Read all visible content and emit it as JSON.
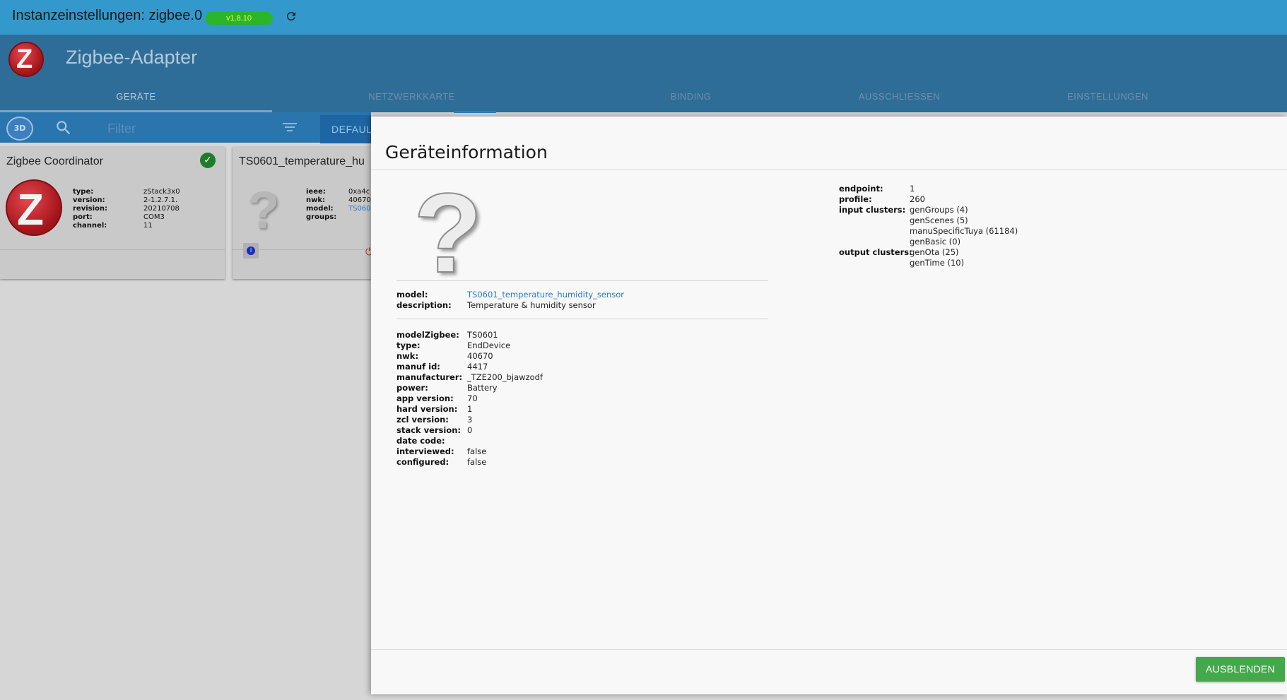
{
  "window": {
    "title": "Instanzeinstellungen: zigbee.0",
    "version": "v1.8.10"
  },
  "app": {
    "title": "Zigbee-Adapter",
    "logo_letter": "Z"
  },
  "tabs": [
    {
      "label": "GERÄTE"
    },
    {
      "label": "NETZWERKKARTE"
    },
    {
      "label": "BINDING"
    },
    {
      "label": "AUSSCHLIESSEN"
    },
    {
      "label": "EINSTELLUNGEN"
    }
  ],
  "toolbar": {
    "btn3d_label": "3D",
    "filter_placeholder": "Filter",
    "default_label": "DEFAUL"
  },
  "coordinator_card": {
    "title": "Zigbee Coordinator",
    "props": [
      {
        "k": "type:",
        "v": "zStack3x0"
      },
      {
        "k": "version:",
        "v": "2-1.2.7.1."
      },
      {
        "k": "revision:",
        "v": "20210708"
      },
      {
        "k": "port:",
        "v": "COM3"
      },
      {
        "k": "channel:",
        "v": "11"
      }
    ]
  },
  "device_card": {
    "title": "TS0601_temperature_hu",
    "props": [
      {
        "k": "ieee:",
        "v": "0xa4c"
      },
      {
        "k": "nwk:",
        "v": "40670"
      },
      {
        "k": "model:",
        "v": "TS060"
      },
      {
        "k": "groups:",
        "v": ""
      }
    ]
  },
  "dialog": {
    "title": "Geräteinformation",
    "model_section": [
      {
        "k": "model:",
        "v": "TS0601_temperature_humidity_sensor",
        "link": true
      },
      {
        "k": "description:",
        "v": "Temperature & humidity sensor"
      }
    ],
    "details": [
      {
        "k": "modelZigbee:",
        "v": "TS0601"
      },
      {
        "k": "type:",
        "v": "EndDevice"
      },
      {
        "k": "nwk:",
        "v": "40670"
      },
      {
        "k": "manuf id:",
        "v": "4417"
      },
      {
        "k": "manufacturer:",
        "v": "_TZE200_bjawzodf"
      },
      {
        "k": "power:",
        "v": "Battery"
      },
      {
        "k": "app version:",
        "v": "70"
      },
      {
        "k": "hard version:",
        "v": "1"
      },
      {
        "k": "zcl version:",
        "v": "3"
      },
      {
        "k": "stack version:",
        "v": "0"
      },
      {
        "k": "date code:",
        "v": ""
      },
      {
        "k": "interviewed:",
        "v": "false"
      },
      {
        "k": "configured:",
        "v": "false"
      }
    ],
    "endpoint": [
      {
        "k": "endpoint:",
        "v": "1"
      },
      {
        "k": "profile:",
        "v": "260"
      },
      {
        "k": "input clusters:",
        "v": "genGroups (4)"
      },
      {
        "k": "",
        "v": "genScenes (5)"
      },
      {
        "k": "",
        "v": "manuSpecificTuya (61184)"
      },
      {
        "k": "",
        "v": "genBasic (0)"
      },
      {
        "k": "output clusters:",
        "v": "genOta (25)"
      },
      {
        "k": "",
        "v": "genTime (10)"
      }
    ],
    "hide_button": "AUSBLENDEN"
  }
}
